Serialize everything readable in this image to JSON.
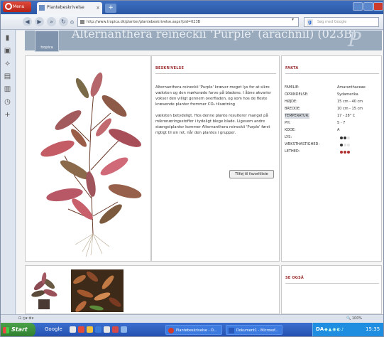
{
  "browser": {
    "menu_label": "Menu",
    "tab_title": "Plantebeskrivelse",
    "tab_close": "x",
    "new_tab": "+",
    "url": "http://www.tropica.dk/planter/plantebeskrivelse.aspx?pid=023B",
    "search_placeholder": "Søg med Google",
    "search_engine_glyph": "g",
    "zoom": "100%"
  },
  "page": {
    "title": "Alternanthera reineckii 'Purple' (arachnil) (023B)",
    "logo_text": "tropica",
    "brand_mark": "P"
  },
  "description": {
    "heading": "BESKRIVELSE",
    "paragraphs": [
      "Alternanthera reineckii 'Purple' kræver meget lys for at sikre væksten og den mørkerøde farve på bladene. I åbne akvarier vokser den villigt gennem overfladen, og som hos de fleste krævende planter fremmer CO₂ tilsætning",
      "væksten betydeligt. Hos denne plante resulterer mangel på mikronæringsstoffer i tydeligt blege blade. Ligesom andre stængelplanter kommer Alternanthera reineckii 'Purple' først rigtigt til sin ret, når den plantes i grupper."
    ],
    "favorite_button": "Tilføj til favoritliste"
  },
  "facts": {
    "heading": "FAKTA",
    "rows": [
      {
        "label": "FAMILIE:",
        "value": "Amaranthaceae"
      },
      {
        "label": "OPRINDELSE:",
        "value": "Sydamerika"
      },
      {
        "label": "HØJDE:",
        "value": "15 cm - 40 cm"
      },
      {
        "label": "BREDDE:",
        "value": "10 cm - 15 cm"
      },
      {
        "label": "TEMPERATUR:",
        "value": "17 - 28° C"
      },
      {
        "label": "PH:",
        "value": "5 - 7"
      },
      {
        "label": "KODE:",
        "value": "A"
      }
    ],
    "ratings": [
      {
        "label": "LYS:",
        "level": 2,
        "max": 3,
        "color": "#333333"
      },
      {
        "label": "VÆKSTHASTIGHED:",
        "level": 1,
        "max": 3,
        "color": "#333333"
      },
      {
        "label": "LETHED:",
        "level": 3,
        "max": 3,
        "color": "#b03030"
      }
    ]
  },
  "see_also": {
    "heading": "SE OGSÅ"
  },
  "taskbar": {
    "start": "Start",
    "google": "Google",
    "tasks": [
      {
        "label": "Plantebeskrivelse - O..."
      },
      {
        "label": "Dokument1 - Microsof..."
      }
    ],
    "language": "DA",
    "clock": "15:35"
  }
}
